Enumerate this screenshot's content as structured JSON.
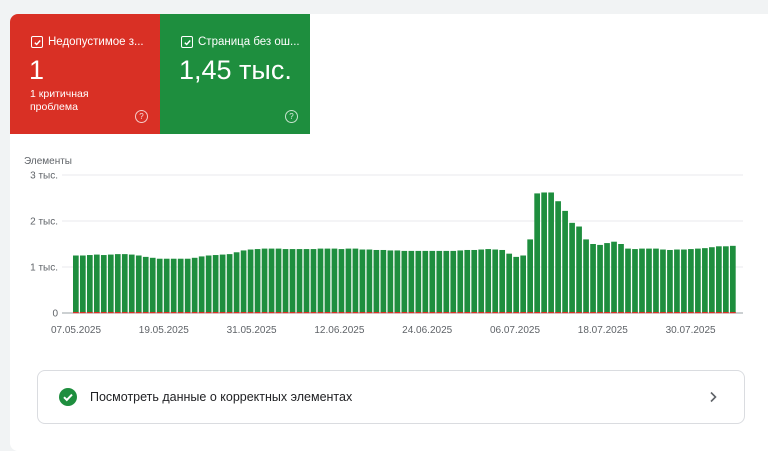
{
  "tiles": [
    {
      "title": "Недопустимое з...",
      "value": "1",
      "subtitle": "1 критичная проблема",
      "color": "#d93025",
      "checked": true,
      "help_icon": "help-circle-icon"
    },
    {
      "title": "Страница без ош...",
      "value": "1,45 тыс.",
      "subtitle": "",
      "color": "#1e8e3e",
      "checked": true,
      "help_icon": "help-circle-icon"
    }
  ],
  "chart_data": {
    "type": "bar",
    "ylabel": "Элементы",
    "yticks": [
      "0",
      "1 тыс.",
      "2 тыс.",
      "3 тыс."
    ],
    "ylim": [
      0,
      3000
    ],
    "xticks": [
      "07.05.2025",
      "19.05.2025",
      "31.05.2025",
      "12.06.2025",
      "24.06.2025",
      "06.07.2025",
      "18.07.2025",
      "30.07.2025"
    ],
    "grid": true,
    "series": [
      {
        "color": "#1e8e3e",
        "values": [
          1250,
          1250,
          1260,
          1270,
          1260,
          1270,
          1280,
          1280,
          1270,
          1250,
          1220,
          1200,
          1180,
          1180,
          1180,
          1180,
          1180,
          1200,
          1230,
          1250,
          1260,
          1270,
          1280,
          1320,
          1360,
          1380,
          1390,
          1400,
          1400,
          1400,
          1390,
          1390,
          1390,
          1390,
          1390,
          1400,
          1400,
          1400,
          1390,
          1400,
          1400,
          1380,
          1380,
          1370,
          1370,
          1360,
          1360,
          1350,
          1350,
          1350,
          1350,
          1350,
          1350,
          1350,
          1350,
          1360,
          1370,
          1370,
          1380,
          1390,
          1380,
          1370,
          1290,
          1220,
          1250,
          1600,
          2600,
          2620,
          2620,
          2430,
          2220,
          1960,
          1880,
          1600,
          1500,
          1480,
          1520,
          1550,
          1500,
          1400,
          1390,
          1400,
          1400,
          1400,
          1380,
          1370,
          1380,
          1380,
          1390,
          1400,
          1410,
          1430,
          1450,
          1450,
          1460
        ]
      },
      {
        "color": "#d93025",
        "values": [
          1,
          1,
          1,
          1,
          1,
          1,
          1,
          1,
          1,
          1,
          1,
          1,
          1,
          1,
          1,
          1,
          1,
          1,
          1,
          1,
          1,
          1,
          1,
          1,
          1,
          1,
          1,
          1,
          1,
          1,
          1,
          1,
          1,
          1,
          1,
          1,
          1,
          1,
          1,
          1,
          1,
          1,
          1,
          1,
          1,
          1,
          1,
          1,
          1,
          1,
          1,
          1,
          1,
          1,
          1,
          1,
          1,
          1,
          1,
          1,
          1,
          1,
          1,
          1,
          1,
          1,
          1,
          1,
          1,
          1,
          1,
          1,
          1,
          1,
          1,
          1,
          1,
          1,
          1,
          1,
          1,
          1,
          1,
          1,
          1,
          1,
          1,
          1,
          1,
          1,
          1,
          1,
          1,
          1,
          1
        ]
      }
    ]
  },
  "link": {
    "label": "Посмотреть данные о корректных элементах",
    "icon": "check-circle-icon",
    "chevron": "chevron-right-icon",
    "icon_color": "#1e8e3e"
  }
}
